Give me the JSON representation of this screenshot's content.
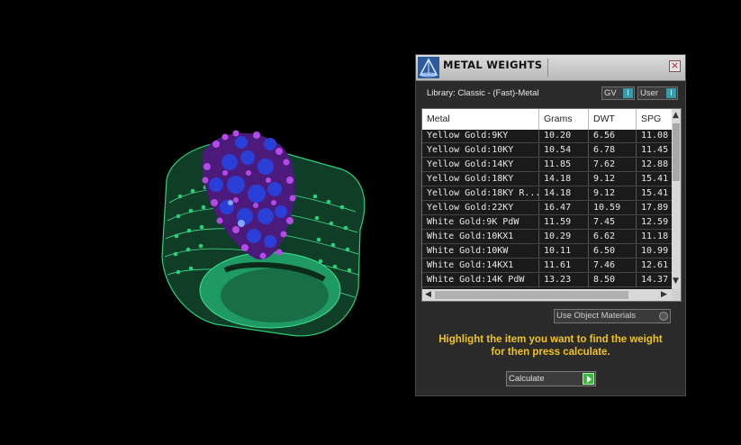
{
  "panel": {
    "title": "METAL WEIGHTS",
    "close_label": "×",
    "library_label": "Library: Classic - (Fast)-Metal",
    "gv_label": "GV",
    "gv_indicator": "I",
    "user_label": "User",
    "user_indicator": "I",
    "columns": [
      "Metal",
      "Grams",
      "DWT",
      "SPG"
    ],
    "rows": [
      [
        "Yellow Gold:9KY",
        "10.20",
        "6.56",
        "11.08"
      ],
      [
        "Yellow Gold:10KY",
        "10.54",
        "6.78",
        "11.45"
      ],
      [
        "Yellow Gold:14KY",
        "11.85",
        "7.62",
        "12.88"
      ],
      [
        "Yellow Gold:18KY",
        "14.18",
        "9.12",
        "15.41"
      ],
      [
        "Yellow Gold:18KY R...",
        "14.18",
        "9.12",
        "15.41"
      ],
      [
        "Yellow Gold:22KY",
        "16.47",
        "10.59",
        "17.89"
      ],
      [
        "White Gold:9K PdW",
        "11.59",
        "7.45",
        "12.59"
      ],
      [
        "White Gold:10KX1",
        "10.29",
        "6.62",
        "11.18"
      ],
      [
        "White Gold:10KW",
        "10.11",
        "6.50",
        "10.99"
      ],
      [
        "White Gold:14KX1",
        "11.61",
        "7.46",
        "12.61"
      ],
      [
        "White Gold:14K PdW",
        "13.23",
        "8.50",
        "14.37"
      ]
    ],
    "use_object_materials_label": "Use Object Materials",
    "hint_line1": "Highlight the item you want to find the weight",
    "hint_line2": "for then press calculate.",
    "calculate_label": "Calculate"
  },
  "colors": {
    "background": "#000000",
    "panel_bg": "#2b2b2b",
    "hint_text": "#f0c419",
    "toggle_indicator": "#3a9aa8",
    "calculate_go": "#3cb73c",
    "ring_band": "#1f9a62",
    "gem_blue": "#2a3fd8",
    "gem_purple": "#9a2fd0"
  },
  "icons": {
    "app": "triangle-logo-icon",
    "close": "close-icon",
    "scroll_up": "chevron-up-icon",
    "scroll_down": "chevron-down-icon",
    "scroll_left": "chevron-left-icon",
    "scroll_right": "chevron-right-icon",
    "calculate": "play-arrow-icon"
  }
}
